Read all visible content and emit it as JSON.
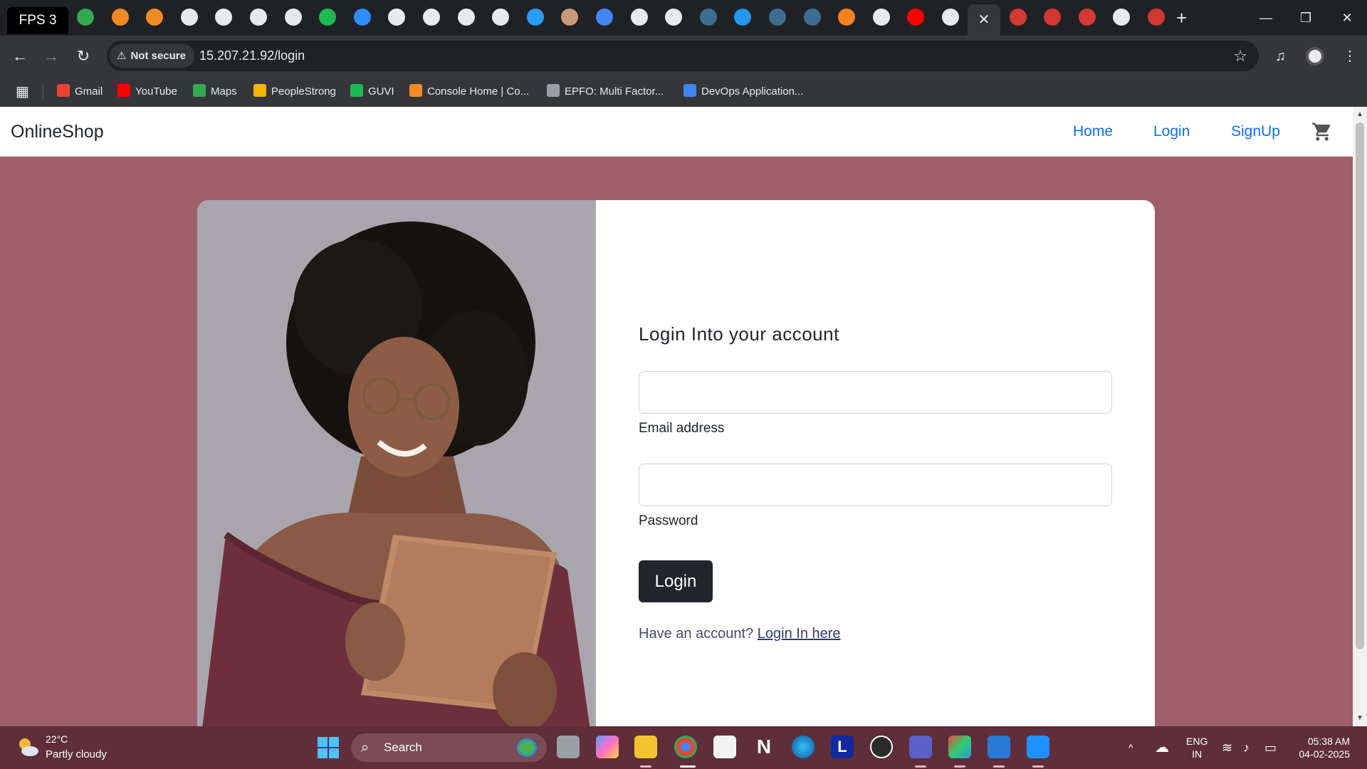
{
  "browser": {
    "fps_label": "FPS 3",
    "tabs": [
      {
        "icon": "google-meet-icon",
        "color": "#34a853"
      },
      {
        "icon": "aws-console-icon",
        "color": "#f08a24"
      },
      {
        "icon": "aws-console-icon",
        "color": "#f08a24"
      },
      {
        "icon": "itp-icon",
        "color": "#e8eaed"
      },
      {
        "icon": "itp-icon",
        "color": "#e8eaed"
      },
      {
        "icon": "itp-icon",
        "color": "#e8eaed"
      },
      {
        "icon": "itp-icon",
        "color": "#e8eaed"
      },
      {
        "icon": "guvi-icon",
        "color": "#1db954"
      },
      {
        "icon": "zoom-icon",
        "color": "#2d8cff"
      },
      {
        "icon": "github-icon",
        "color": "#e8eaed"
      },
      {
        "icon": "github-icon",
        "color": "#e8eaed"
      },
      {
        "icon": "openai-icon",
        "color": "#e8eaed"
      },
      {
        "icon": "openai-icon",
        "color": "#e8eaed"
      },
      {
        "icon": "site-icon",
        "color": "#2a9df4"
      },
      {
        "icon": "avatar-icon",
        "color": "#c89a7a"
      },
      {
        "icon": "google-docs-icon",
        "color": "#4285f4"
      },
      {
        "icon": "google-icon",
        "color": "#e8eaed"
      },
      {
        "icon": "google-icon",
        "color": "#e8eaed"
      },
      {
        "icon": "site-icon",
        "color": "#3c6e91"
      },
      {
        "icon": "docker-icon",
        "color": "#2496ed"
      },
      {
        "icon": "site-icon",
        "color": "#3c6e91"
      },
      {
        "icon": "site-icon",
        "color": "#3c6e91"
      },
      {
        "icon": "stackoverflow-icon",
        "color": "#f48024"
      },
      {
        "icon": "google-icon",
        "color": "#e8eaed"
      },
      {
        "icon": "youtube-icon",
        "color": "#ff0000"
      },
      {
        "icon": "github-icon",
        "color": "#e8eaed"
      },
      {
        "icon": "jenkins-icon",
        "color": "#d33833"
      },
      {
        "icon": "jenkins-icon",
        "color": "#d33833"
      },
      {
        "icon": "jenkins-icon",
        "color": "#d33833"
      },
      {
        "icon": "google-icon",
        "color": "#e8eaed"
      },
      {
        "icon": "jenkins-icon",
        "color": "#d33833"
      }
    ],
    "active_tab_close": "✕",
    "new_tab": "+",
    "window": {
      "minimize": "—",
      "restore": "❐",
      "close": "✕"
    },
    "nav": {
      "back": "←",
      "forward": "→",
      "reload": "↻"
    },
    "security_label": "Not secure",
    "security_icon": "⚠",
    "url": "15.207.21.92/login",
    "bookmark_star": "☆",
    "media_icon": "♫",
    "menu_icon": "⋮",
    "apps_icon": "▦",
    "bookmarks": [
      {
        "label": "Gmail",
        "color": "#ea4335"
      },
      {
        "label": "YouTube",
        "color": "#ff0000"
      },
      {
        "label": "Maps",
        "color": "#34a853"
      },
      {
        "label": "PeopleStrong",
        "color": "#f4b400"
      },
      {
        "label": "GUVI",
        "color": "#1db954"
      },
      {
        "label": "Console Home | Co...",
        "color": "#f08a24"
      },
      {
        "label": "EPFO: Multi Factor...",
        "color": "#9aa0a6"
      },
      {
        "label": "DevOps Application...",
        "color": "#4285f4"
      }
    ]
  },
  "site": {
    "brand": "OnlineShop",
    "nav": {
      "home": "Home",
      "login": "Login",
      "signup": "SignUp"
    },
    "page_bg": "#9e5f6b",
    "form": {
      "title": "Login Into your account",
      "email_label": "Email address",
      "email_value": "",
      "password_label": "Password",
      "password_value": "",
      "submit": "Login",
      "account_prompt": "Have an account?",
      "account_link": "Login In here"
    }
  },
  "taskbar": {
    "weather_temp": "22°C",
    "weather_desc": "Partly cloudy",
    "search_label": "Search",
    "search_icon": "⌕",
    "lang_line1": "ENG",
    "lang_line2": "IN",
    "time": "05:38 AM",
    "date": "04-02-2025",
    "tray_chevron": "^"
  }
}
